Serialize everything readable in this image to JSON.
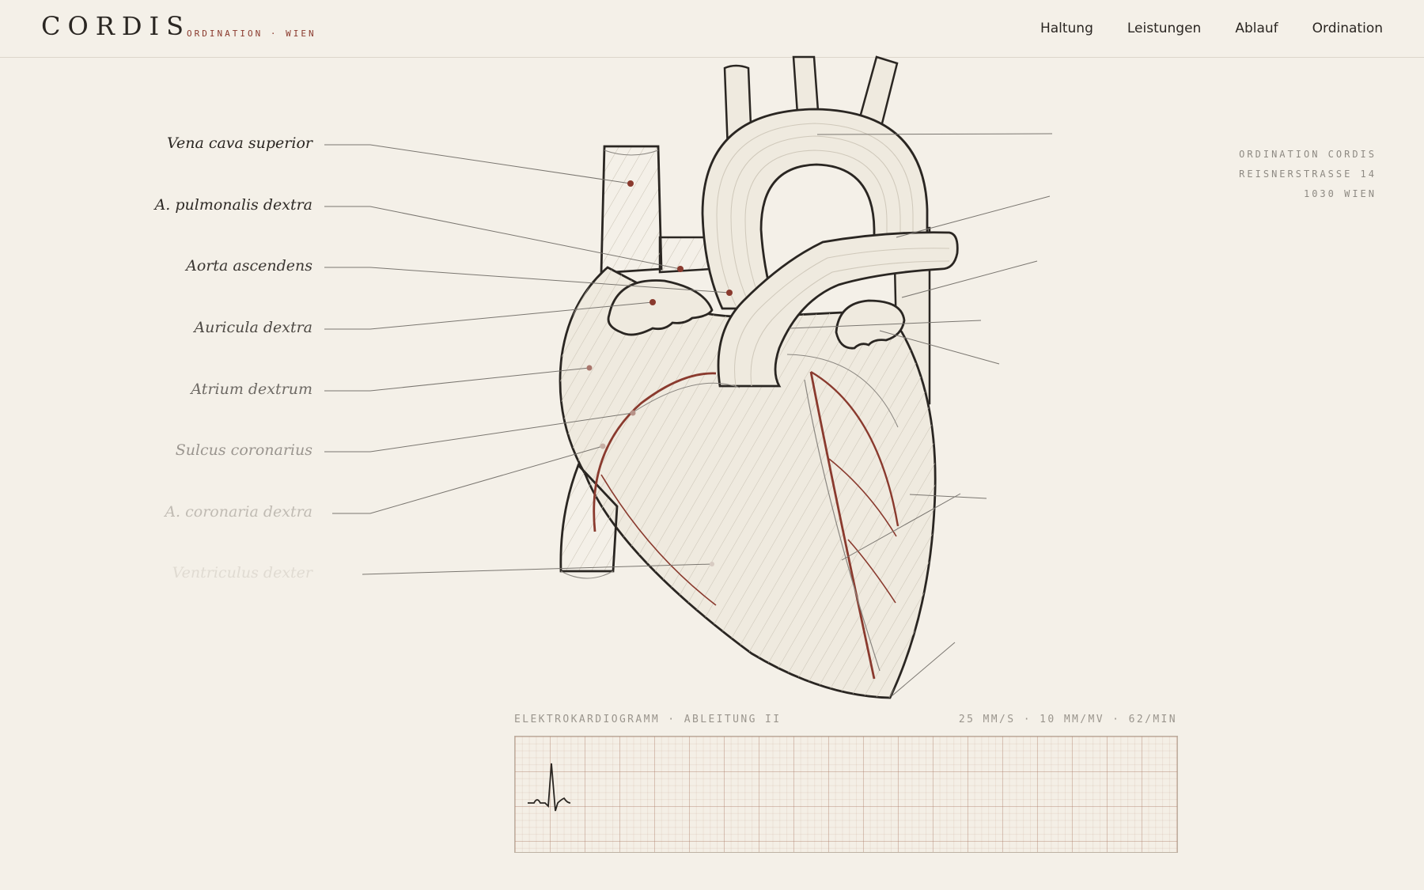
{
  "header": {
    "brand": "CORDIS",
    "brand_sub": "ORDINATION · WIEN",
    "nav": [
      "Haltung",
      "Leistungen",
      "Ablauf",
      "Ordination"
    ]
  },
  "address": [
    "ORDINATION CORDIS",
    "REISNERSTRASSE 14",
    "1030 WIEN"
  ],
  "anatomy_labels": [
    "Vena cava superior",
    "A. pulmonalis dextra",
    "Aorta ascendens",
    "Auricula dextra",
    "Atrium dextrum",
    "Sulcus coronarius",
    "A. coronaria dextra",
    "Ventriculus dexter"
  ],
  "ecg": {
    "title": "ELEKTROKARDIOGRAMM · ABLEITUNG II",
    "settings": "25 MM/S · 10 MM/MV · 62/MIN"
  },
  "colors": {
    "background": "#f4f0e8",
    "ink": "#2a2622",
    "accent": "#8a3a2e",
    "tissue": "#efeadf"
  }
}
